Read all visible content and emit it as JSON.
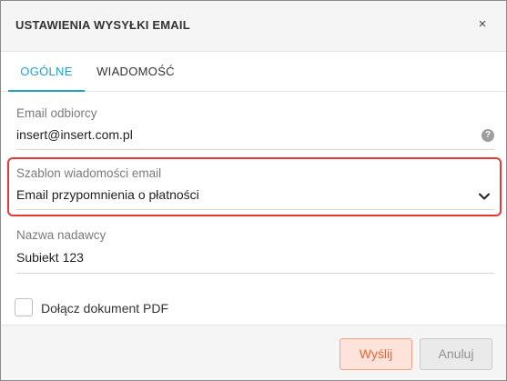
{
  "dialog": {
    "title": "USTAWIENIA WYSYŁKI EMAIL",
    "close_glyph": "×"
  },
  "tabs": [
    {
      "label": "OGÓLNE",
      "active": true
    },
    {
      "label": "WIADOMOŚĆ",
      "active": false
    }
  ],
  "fields": {
    "recipient": {
      "label": "Email odbiorcy",
      "value": "insert@insert.com.pl",
      "help_icon": "?"
    },
    "template": {
      "label": "Szablon wiadomości email",
      "value": "Email przypomnienia o płatności",
      "icon": "chevron-down-icon"
    },
    "sender": {
      "label": "Nazwa nadawcy",
      "value": "Subiekt 123"
    }
  },
  "attach_pdf": {
    "label": "Dołącz dokument PDF",
    "checked": false
  },
  "buttons": {
    "send": "Wyślij",
    "cancel": "Anuluj"
  },
  "colors": {
    "accent": "#23a2c4",
    "highlight": "#e53935",
    "send_text": "#e8653a",
    "send_bg": "#fde3d9"
  }
}
